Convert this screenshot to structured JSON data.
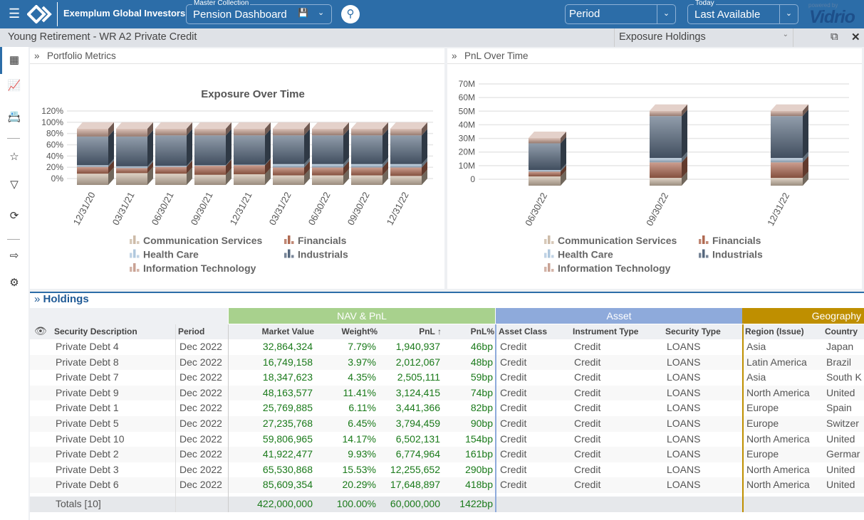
{
  "header": {
    "brand": "Exemplum Global Investors",
    "master_collection_label": "Master Collection",
    "master_collection_value": "Pension Dashboard",
    "period_value": "Period",
    "today_label": "Today",
    "today_value": "Last Available",
    "powered_by": "powered by",
    "vendor_logo": "Vidrio"
  },
  "subbar": {
    "title": "Young Retirement - WR A2 Private Credit",
    "view_select": "Exposure Holdings"
  },
  "sidebar": {
    "items": [
      "grid-icon",
      "line-chart-icon",
      "id-card-icon",
      "star-icon",
      "filter-icon",
      "refresh-icon",
      "export-icon",
      "gear-icon"
    ]
  },
  "panels": {
    "portfolio_metrics": "Portfolio Metrics",
    "pnl_over_time": "PnL Over Time",
    "holdings": "Holdings"
  },
  "colors": {
    "Communication Services": "#cdbba8",
    "Financials": "#b06a52",
    "Health Care": "#b0c8de",
    "Industrials": "#56687e",
    "Information Technology": "#c9a294",
    "brand": "#2c6da8",
    "nav_group": "#a8d18d",
    "asset_group": "#8eaadb",
    "geo_group": "#bf8f00"
  },
  "chart_data": [
    {
      "type": "bar",
      "stacked": true,
      "three_d": true,
      "title": "Exposure Over Time",
      "ylim": [
        0,
        120
      ],
      "yticks": [
        "0%",
        "20%",
        "40%",
        "60%",
        "80%",
        "100%",
        "120%"
      ],
      "grid": true,
      "legend_placement": "bottom",
      "categories": [
        "12/31/20",
        "03/31/21",
        "06/30/21",
        "09/30/21",
        "12/31/21",
        "03/31/22",
        "06/30/22",
        "09/30/22",
        "12/31/22"
      ],
      "series": [
        {
          "name": "Communication Services",
          "values": [
            20,
            21,
            20,
            18,
            19,
            17,
            17,
            17,
            16
          ]
        },
        {
          "name": "Financials",
          "values": [
            12,
            9,
            12,
            16,
            16,
            14,
            14,
            14,
            15
          ]
        },
        {
          "name": "Health Care",
          "values": [
            3,
            3,
            2,
            1,
            1,
            6,
            6,
            6,
            6
          ]
        },
        {
          "name": "Industrials",
          "values": [
            51,
            53,
            54,
            53,
            52,
            51,
            51,
            51,
            51
          ]
        },
        {
          "name": "Information Technology",
          "values": [
            14,
            14,
            12,
            12,
            12,
            12,
            12,
            12,
            12
          ]
        }
      ]
    },
    {
      "type": "bar",
      "stacked": true,
      "three_d": true,
      "title": "",
      "ylim": [
        0,
        70
      ],
      "yticks": [
        "0",
        "10M",
        "20M",
        "30M",
        "40M",
        "50M",
        "60M",
        "70M"
      ],
      "grid": true,
      "legend_placement": "bottom",
      "categories": [
        "06/30/22",
        "09/30/22",
        "12/31/22"
      ],
      "series": [
        {
          "name": "Communication Services",
          "values": [
            6.8,
            5.7,
            5.7
          ]
        },
        {
          "name": "Financials",
          "values": [
            3.5,
            11.4,
            11.4
          ]
        },
        {
          "name": "Health Care",
          "values": [
            1.2,
            3.2,
            3.2
          ]
        },
        {
          "name": "Industrials",
          "values": [
            19.6,
            30.8,
            30.8
          ]
        },
        {
          "name": "Information Technology",
          "values": [
            3.9,
            3.9,
            3.9
          ]
        }
      ]
    }
  ],
  "table": {
    "groups": [
      "NAV & PnL",
      "Asset",
      "Geography"
    ],
    "columns": [
      "Security Description",
      "Period",
      "Market Value",
      "Weight%",
      "PnL ↑",
      "PnL%",
      "Asset Class",
      "Instrument Type",
      "Security Type",
      "Region (Issue)",
      "Country"
    ],
    "rows": [
      [
        "Private Debt 4",
        "Dec 2022",
        "32,864,324",
        "7.79%",
        "1,940,937",
        "46bp",
        "Credit",
        "Credit",
        "LOANS",
        "Asia",
        "Japan"
      ],
      [
        "Private Debt 8",
        "Dec 2022",
        "16,749,158",
        "3.97%",
        "2,012,067",
        "48bp",
        "Credit",
        "Credit",
        "LOANS",
        "Latin America",
        "Brazil"
      ],
      [
        "Private Debt 7",
        "Dec 2022",
        "18,347,623",
        "4.35%",
        "2,505,111",
        "59bp",
        "Credit",
        "Credit",
        "LOANS",
        "Asia",
        "South K"
      ],
      [
        "Private Debt 9",
        "Dec 2022",
        "48,163,577",
        "11.41%",
        "3,124,415",
        "74bp",
        "Credit",
        "Credit",
        "LOANS",
        "North America",
        "United"
      ],
      [
        "Private Debt 1",
        "Dec 2022",
        "25,769,885",
        "6.11%",
        "3,441,366",
        "82bp",
        "Credit",
        "Credit",
        "LOANS",
        "Europe",
        "Spain"
      ],
      [
        "Private Debt 5",
        "Dec 2022",
        "27,235,768",
        "6.45%",
        "3,794,459",
        "90bp",
        "Credit",
        "Credit",
        "LOANS",
        "Europe",
        "Switzer"
      ],
      [
        "Private Debt 10",
        "Dec 2022",
        "59,806,965",
        "14.17%",
        "6,502,131",
        "154bp",
        "Credit",
        "Credit",
        "LOANS",
        "North America",
        "United"
      ],
      [
        "Private Debt 2",
        "Dec 2022",
        "41,922,477",
        "9.93%",
        "6,774,964",
        "161bp",
        "Credit",
        "Credit",
        "LOANS",
        "Europe",
        "Germar"
      ],
      [
        "Private Debt 3",
        "Dec 2022",
        "65,530,868",
        "15.53%",
        "12,255,652",
        "290bp",
        "Credit",
        "Credit",
        "LOANS",
        "North America",
        "United"
      ],
      [
        "Private Debt 6",
        "Dec 2022",
        "85,609,354",
        "20.29%",
        "17,648,897",
        "418bp",
        "Credit",
        "Credit",
        "LOANS",
        "North America",
        "United"
      ]
    ],
    "totals": [
      "Totals [10]",
      "",
      "422,000,000",
      "100.00%",
      "60,000,000",
      "1422bp",
      "",
      "",
      "",
      "",
      ""
    ]
  }
}
